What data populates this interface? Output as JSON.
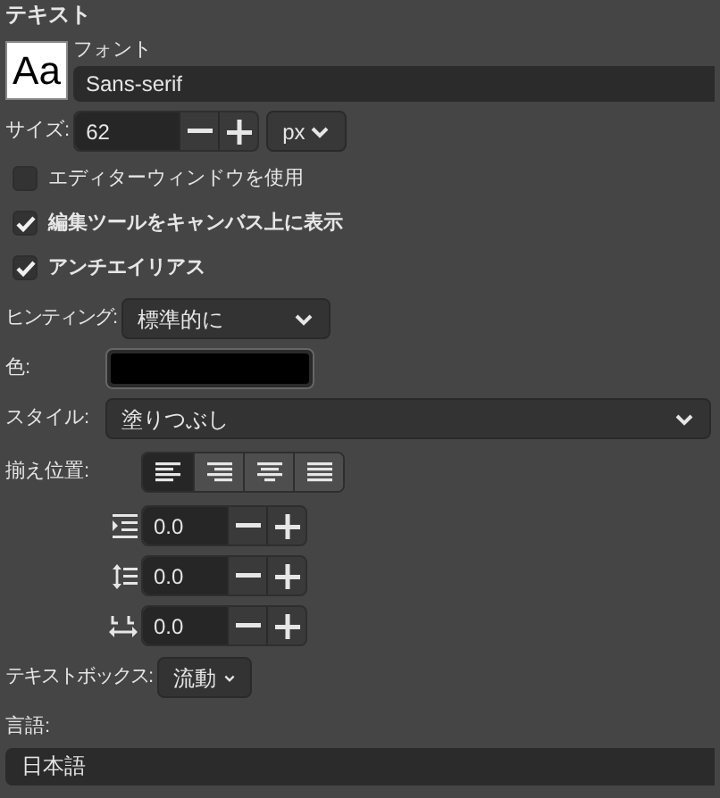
{
  "title": "テキスト",
  "font": {
    "preview": "Aa",
    "label": "フォント",
    "value": "Sans-serif"
  },
  "size": {
    "label": "サイズ:",
    "value": "62",
    "unit": "px"
  },
  "options": [
    {
      "label": "エディターウィンドウを使用",
      "checked": false
    },
    {
      "label": "編集ツールをキャンバス上に表示",
      "checked": true
    },
    {
      "label": "アンチエイリアス",
      "checked": true
    }
  ],
  "hinting": {
    "label": "ヒンティング:",
    "value": "標準的に"
  },
  "color": {
    "label": "色:",
    "color": "#000000"
  },
  "style": {
    "label": "スタイル:",
    "value": "塗りつぶし"
  },
  "justify": {
    "label": "揃え位置:",
    "buttons": [
      {
        "kind": "left",
        "selected": true
      },
      {
        "kind": "right",
        "selected": false
      },
      {
        "kind": "center",
        "selected": false
      },
      {
        "kind": "fill",
        "selected": false
      }
    ]
  },
  "spacing": [
    {
      "kind": "indent",
      "value": "0.0"
    },
    {
      "kind": "line",
      "value": "0.0"
    },
    {
      "kind": "letter",
      "value": "0.0"
    }
  ],
  "textbox": {
    "label": "テキストボックス:",
    "value": "流動"
  },
  "language": {
    "label": "言語:",
    "value": "日本語"
  }
}
